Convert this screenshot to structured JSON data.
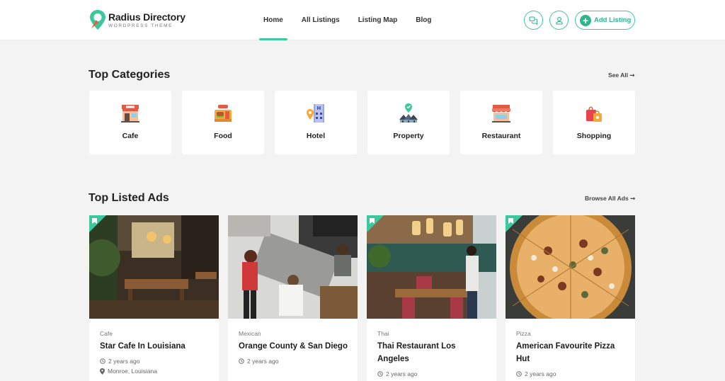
{
  "header": {
    "logo_title": "Radius Directory",
    "logo_subtitle": "WordPress Theme",
    "nav": [
      {
        "label": "Home",
        "active": true
      },
      {
        "label": "All Listings",
        "active": false
      },
      {
        "label": "Listing Map",
        "active": false
      },
      {
        "label": "Blog",
        "active": false
      }
    ],
    "chat_icon": "chat-icon",
    "user_icon": "user-icon",
    "add_listing_label": "Add Listing"
  },
  "categories_section": {
    "title": "Top Categories",
    "see_all": "See All",
    "items": [
      {
        "label": "Cafe",
        "icon": "cafe-icon"
      },
      {
        "label": "Food",
        "icon": "food-icon"
      },
      {
        "label": "Hotel",
        "icon": "hotel-icon"
      },
      {
        "label": "Property",
        "icon": "property-icon"
      },
      {
        "label": "Restaurant",
        "icon": "restaurant-icon"
      },
      {
        "label": "Shopping",
        "icon": "shopping-icon"
      }
    ]
  },
  "ads_section": {
    "title": "Top Listed Ads",
    "browse_all": "Browse All Ads",
    "items": [
      {
        "category": "Cafe",
        "title": "Star Cafe In Louisiana",
        "time": "2 years ago",
        "location": "Monroe, Louisiana"
      },
      {
        "category": "Mexican",
        "title": "Orange County & San Diego",
        "time": "2 years ago"
      },
      {
        "category": "Thai",
        "title": "Thai Restaurant Los Angeles",
        "time": "2 years ago"
      },
      {
        "category": "Pizza",
        "title": "American Favourite Pizza Hut",
        "time": "2 years ago"
      }
    ]
  },
  "colors": {
    "accent": "#3cc79d",
    "background": "#f3f3f3"
  }
}
